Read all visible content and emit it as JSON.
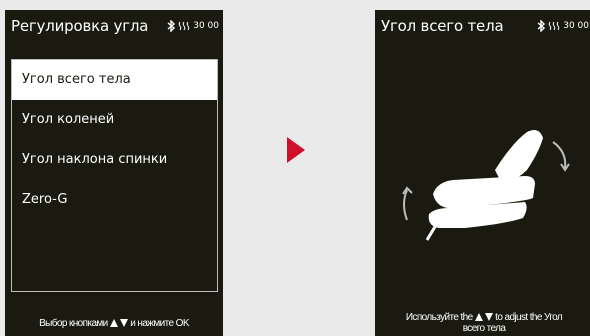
{
  "left_screen": {
    "title": "Регулировка угла",
    "status_time": "30 00",
    "menu": [
      {
        "label": "Угол всего тела",
        "selected": true
      },
      {
        "label": "Угол коленей",
        "selected": false
      },
      {
        "label": "Угол наклона спинки",
        "selected": false
      },
      {
        "label": "Zero-G",
        "selected": false
      }
    ],
    "hint_before": "Выбор кнопками",
    "hint_after": "и нажмите OK"
  },
  "right_screen": {
    "title": "Угол всего тела",
    "status_time": "30 00",
    "hint_before": "Используйте the",
    "hint_after": "to adjust the Угол",
    "hint_line2": "всего тела"
  },
  "icons": {
    "bluetooth": "bluetooth-icon",
    "heat": "heat-icon",
    "next_arrow": "next-arrow-icon"
  },
  "colors": {
    "screen_bg": "#1a1a10",
    "accent": "#d0112b",
    "page_bg": "#eaeaea"
  }
}
